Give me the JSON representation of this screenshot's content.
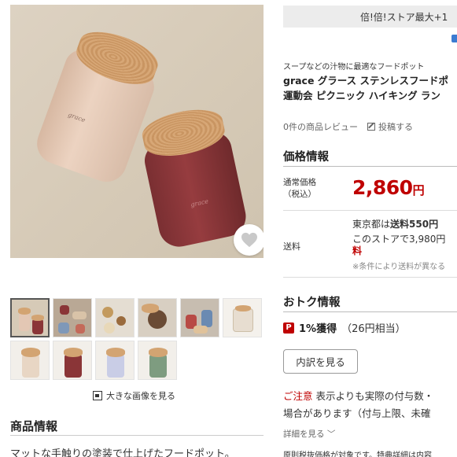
{
  "gallery": {
    "main_image_brand": "grace",
    "favorite_icon": "heart-icon",
    "enlarge_label": "大きな画像を見る"
  },
  "left": {
    "section_title": "商品情報",
    "description": "マットな手触りの塗装で仕上げたフードポット。"
  },
  "right": {
    "promo_text": "倍!倍!ストア最大+1",
    "catchcopy": "スープなどの汁物に最適なフードポット",
    "title_line1": "grace グラース ステンレスフードポ",
    "title_line2": "運動会 ピクニック ハイキング ラン",
    "reviews_text": "0件の商品レビュー",
    "post_label": "投稿する",
    "price_heading": "価格情報",
    "price_label_1": "通常価格",
    "price_label_2": "（税込）",
    "price_value": "2,860",
    "price_unit": "円",
    "shipping_label": "送料",
    "shipping_line1_prefix": "東京都は",
    "shipping_line1_bold": "送料550円",
    "shipping_line2": "このストアで3,980円",
    "shipping_line3": "料",
    "shipping_note": "※条件により送料が異なる",
    "otoku_heading": "おトク情報",
    "points_bold": "1%獲得",
    "points_sub": "（26円相当）",
    "breakdown_button": "内訳を見る",
    "notice_label": "ご注意",
    "notice_line1": "表示よりも実際の付与数・",
    "notice_line2": "場合があります（付与上限、未確",
    "details_label": "詳細を見る ﹀",
    "bottom_note": "原則税抜価格が対象です。特典詳細は内容"
  },
  "colors": {
    "accent_red": "#bf0000",
    "promo_bg": "#ececec"
  }
}
